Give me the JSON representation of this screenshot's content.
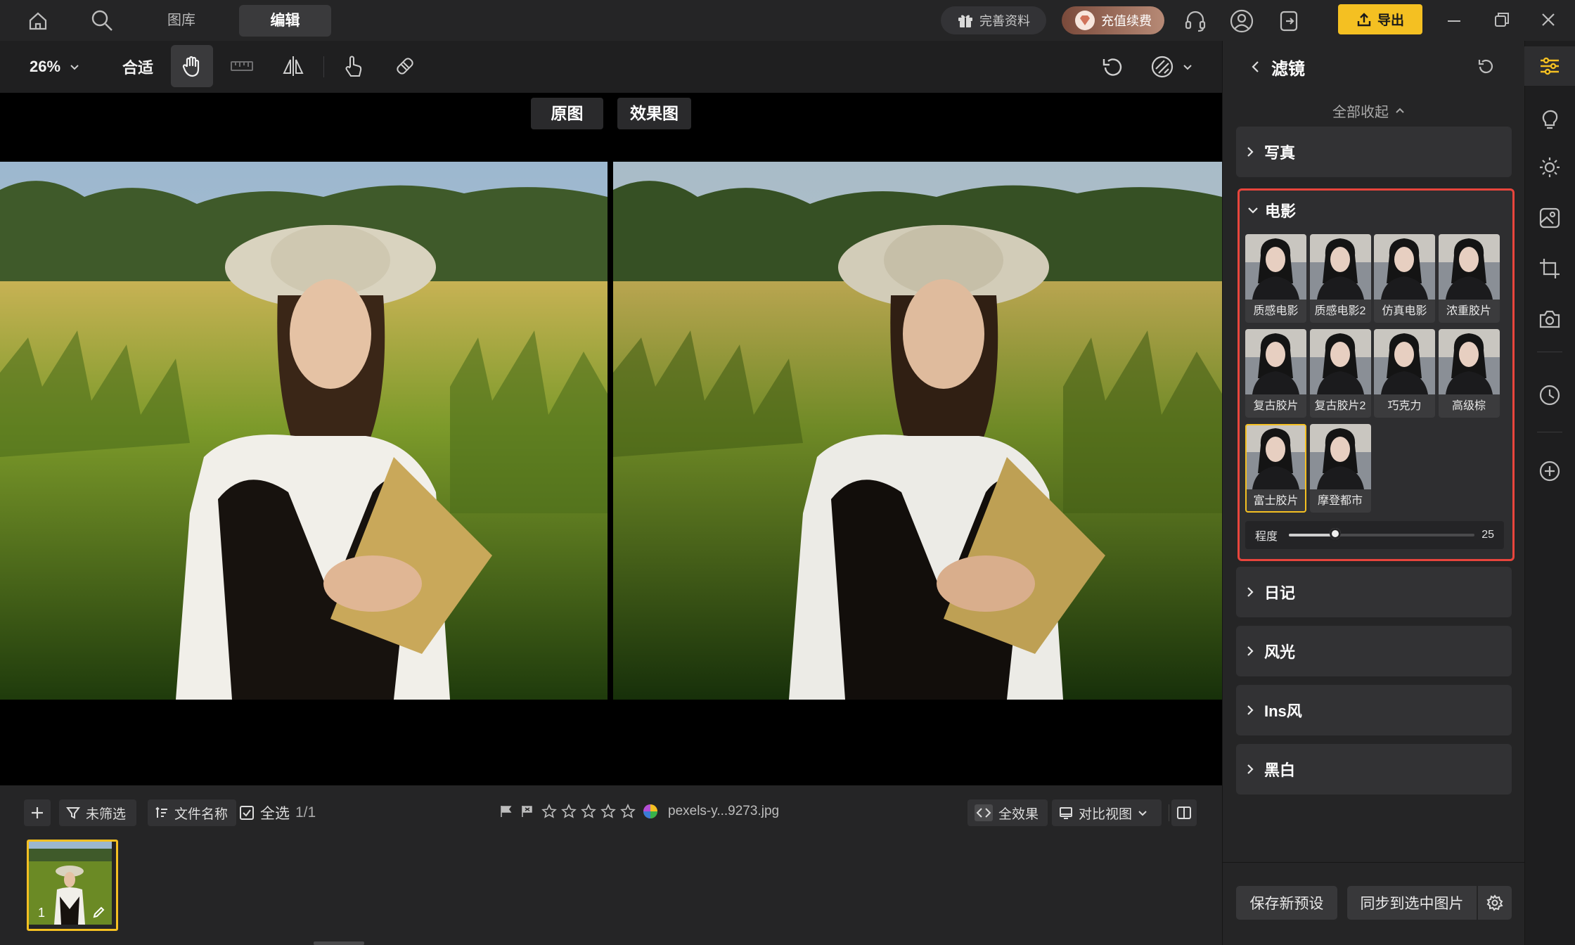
{
  "header": {
    "tabs": {
      "gallery": "图库",
      "edit": "编辑"
    },
    "profile_label": "完善资料",
    "recharge_label": "充值续费",
    "export_label": "导出"
  },
  "toolbar": {
    "zoom": "26%",
    "fit": "合适"
  },
  "compare": {
    "original": "原图",
    "effect": "效果图"
  },
  "bottombar": {
    "filter_label": "未筛选",
    "sort_label": "文件名称",
    "select_all_label": "全选",
    "selection_count": "1/1",
    "filename": "pexels-y...9273.jpg",
    "effects_label": "全效果",
    "view_label": "对比视图",
    "thumb_index": "1"
  },
  "panel": {
    "title": "滤镜",
    "collapse_all": "全部收起",
    "sections": [
      "写真",
      "日记",
      "风光",
      "Ins风",
      "黑白"
    ],
    "film": {
      "title": "电影",
      "filters": [
        "质感电影",
        "质感电影2",
        "仿真电影",
        "浓重胶片",
        "复古胶片",
        "复古胶片2",
        "巧克力",
        "高级棕",
        "富士胶片",
        "摩登都市"
      ],
      "selected": "富士胶片",
      "strength_label": "程度",
      "strength_value": "25",
      "strength_fraction": 0.25
    },
    "save_preset": "保存新预设",
    "sync_label": "同步到选中图片"
  },
  "colors": {
    "accent": "#f4c022",
    "highlight_border": "#e8453c"
  }
}
